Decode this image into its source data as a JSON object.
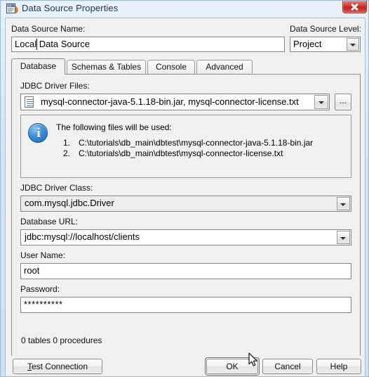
{
  "window": {
    "title": "Data Source Properties",
    "icon": "database-properties-icon",
    "close_label": "✕"
  },
  "header": {
    "data_source_name_label": "Data Source Name:",
    "data_source_name_value": "Local Data Source",
    "data_source_level_label": "Data Source Level:",
    "data_source_level_value": "Project"
  },
  "tabs": [
    {
      "label": "Database",
      "active": true
    },
    {
      "label": "Schemas & Tables",
      "active": false
    },
    {
      "label": "Console",
      "active": false
    },
    {
      "label": "Advanced",
      "active": false
    }
  ],
  "database_tab": {
    "driver_files_label": "JDBC Driver Files:",
    "driver_files_value": "mysql-connector-java-5.1.18-bin.jar, mysql-connector-license.txt",
    "browse_label": "...",
    "info": {
      "title": "The following files will be used:",
      "items": [
        {
          "num": "1.",
          "path": "C:\\tutorials\\db_main\\dbtest\\mysql-connector-java-5.1.18-bin.jar"
        },
        {
          "num": "2.",
          "path": "C:\\tutorials\\db_main\\dbtest\\mysql-connector-license.txt"
        }
      ]
    },
    "driver_class_label": "JDBC Driver Class:",
    "driver_class_value": "com.mysql.jdbc.Driver",
    "database_url_label": "Database URL:",
    "database_url_value": "jdbc:mysql://localhost/clients",
    "user_name_label": "User Name:",
    "user_name_value": "root",
    "password_label": "Password:",
    "password_value": "**********",
    "status": "0 tables 0 procedures"
  },
  "buttons": {
    "test_connection": "Test Connection",
    "test_connection_mnemonic": "T",
    "test_connection_rest": "est Connection",
    "ok": "OK",
    "cancel": "Cancel",
    "help": "Help"
  },
  "colors": {
    "window_frame": "#9bbbd8",
    "client_bg": "#f0f0f0",
    "close_red": "#cf2f27",
    "info_blue": "#1463ae",
    "field_white": "#ffffff",
    "field_readonly": "#ededed"
  }
}
